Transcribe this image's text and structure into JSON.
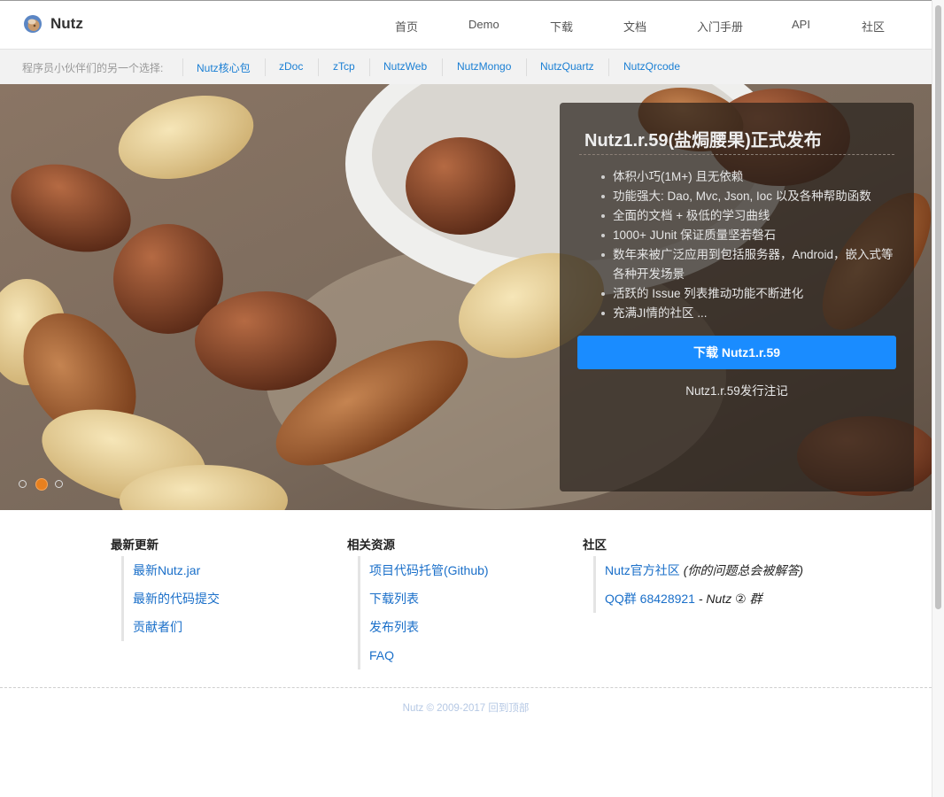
{
  "brand": {
    "name": "Nutz"
  },
  "nav": [
    {
      "label": "首页"
    },
    {
      "label": "Demo"
    },
    {
      "label": "下载"
    },
    {
      "label": "文档"
    },
    {
      "label": "入门手册"
    },
    {
      "label": "API"
    },
    {
      "label": "社区"
    }
  ],
  "subnav": {
    "label": "程序员小伙伴们的另一个选择:",
    "links": [
      {
        "label": "Nutz核心包"
      },
      {
        "label": "zDoc"
      },
      {
        "label": "zTcp"
      },
      {
        "label": "NutzWeb"
      },
      {
        "label": "NutzMongo"
      },
      {
        "label": "NutzQuartz"
      },
      {
        "label": "NutzQrcode"
      }
    ]
  },
  "hero": {
    "title": "Nutz1.r.59(盐焗腰果)正式发布",
    "features": [
      "体积小巧(1M+) 且无依赖",
      "功能强大: Dao, Mvc, Json, Ioc 以及各种帮助函数",
      "全面的文档 + 极低的学习曲线",
      "1000+ JUnit 保证质量坚若磐石",
      "数年来被广泛应用到包括服务器，Android，嵌入式等各种开发场景",
      "活跃的 Issue 列表推动功能不断进化",
      "充满JI情的社区 ..."
    ],
    "download_label": "下载 Nutz1.r.59",
    "notes_label": "Nutz1.r.59发行注记",
    "slides_total": 3,
    "slide_active": 2
  },
  "columns": [
    {
      "title": "最新更新",
      "items": [
        {
          "link": "最新Nutz.jar",
          "note": ""
        },
        {
          "link": "最新的代码提交",
          "note": ""
        },
        {
          "link": "贡献者们",
          "note": ""
        }
      ]
    },
    {
      "title": "相关资源",
      "items": [
        {
          "link": "项目代码托管(Github)",
          "note": ""
        },
        {
          "link": "下载列表",
          "note": ""
        },
        {
          "link": "发布列表",
          "note": ""
        },
        {
          "link": "FAQ",
          "note": ""
        }
      ]
    },
    {
      "title": "社区",
      "items": [
        {
          "link": "Nutz官方社区",
          "note": "(你的问题总会被解答)"
        },
        {
          "link": "QQ群 68428921",
          "note": "- Nutz ② 群"
        }
      ]
    }
  ],
  "footer": {
    "copyright": "Nutz © 2009-2017",
    "back_to_top": "回到顶部"
  },
  "colors": {
    "accent": "#1a8cff",
    "link": "#1a6fc9",
    "active_dot": "#e8801f"
  }
}
